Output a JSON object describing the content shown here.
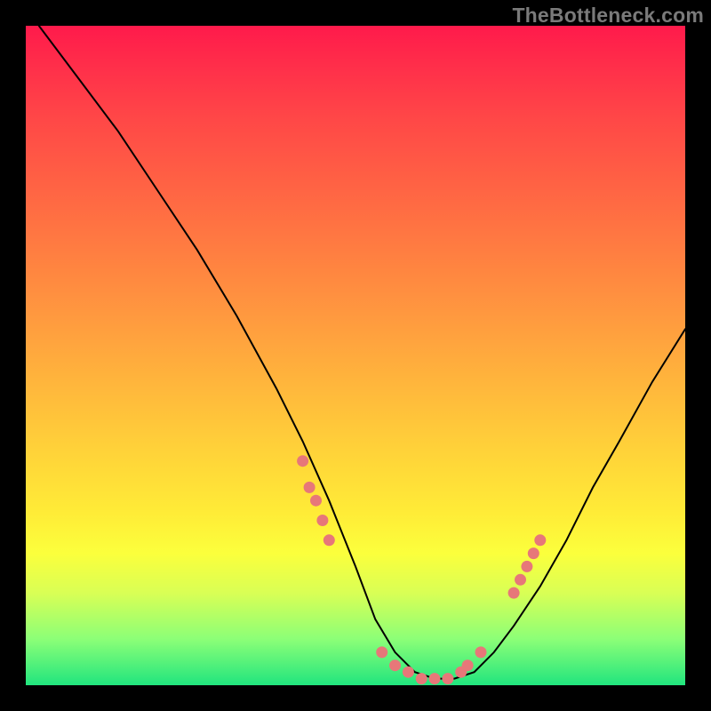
{
  "watermark": "TheBottleneck.com",
  "chart_data": {
    "type": "line",
    "title": "",
    "xlabel": "",
    "ylabel": "",
    "xlim": [
      0,
      100
    ],
    "ylim": [
      0,
      100
    ],
    "grid": false,
    "legend": false,
    "series": [
      {
        "name": "curve",
        "stroke": "#000000",
        "x": [
          2,
          8,
          14,
          20,
          26,
          32,
          38,
          42,
          46,
          50,
          53,
          56,
          59,
          62,
          65,
          68,
          71,
          74,
          78,
          82,
          86,
          90,
          95,
          100
        ],
        "y": [
          100,
          92,
          84,
          75,
          66,
          56,
          45,
          37,
          28,
          18,
          10,
          5,
          2,
          1,
          1,
          2,
          5,
          9,
          15,
          22,
          30,
          37,
          46,
          54
        ]
      }
    ],
    "annotations": {
      "dots_color": "#e77779",
      "dots": [
        {
          "x": 42,
          "y": 34
        },
        {
          "x": 43,
          "y": 30
        },
        {
          "x": 44,
          "y": 28
        },
        {
          "x": 45,
          "y": 25
        },
        {
          "x": 46,
          "y": 22
        },
        {
          "x": 54,
          "y": 5
        },
        {
          "x": 56,
          "y": 3
        },
        {
          "x": 58,
          "y": 2
        },
        {
          "x": 60,
          "y": 1
        },
        {
          "x": 62,
          "y": 1
        },
        {
          "x": 64,
          "y": 1
        },
        {
          "x": 66,
          "y": 2
        },
        {
          "x": 67,
          "y": 3
        },
        {
          "x": 69,
          "y": 5
        },
        {
          "x": 74,
          "y": 14
        },
        {
          "x": 75,
          "y": 16
        },
        {
          "x": 76,
          "y": 18
        },
        {
          "x": 77,
          "y": 20
        },
        {
          "x": 78,
          "y": 22
        }
      ]
    },
    "background_gradient": {
      "direction": "top-to-bottom",
      "stops": [
        {
          "pos": 0.0,
          "color": "#ff1a4b"
        },
        {
          "pos": 0.34,
          "color": "#ff7d41"
        },
        {
          "pos": 0.74,
          "color": "#ffec37"
        },
        {
          "pos": 1.0,
          "color": "#21e57e"
        }
      ]
    }
  }
}
